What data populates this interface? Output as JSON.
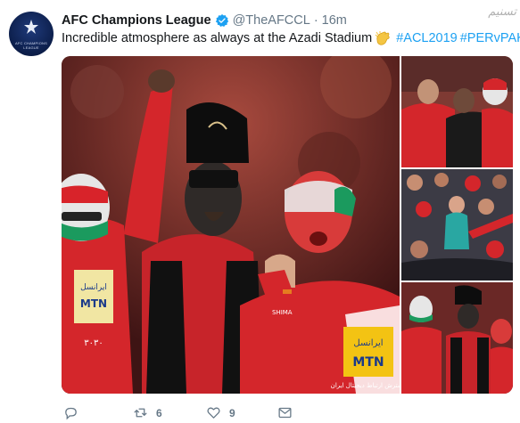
{
  "tweet": {
    "avatar_label": "AFC CHAMPIONS LEAGUE",
    "author_name": "AFC Champions League",
    "handle": "@TheAFCCL",
    "separator": "·",
    "time": "16m",
    "text": "Incredible atmosphere as always at the Azadi Stadium",
    "hashtags": [
      "#ACL2019",
      "#PERvPAK"
    ],
    "watermark": "تسنیم",
    "photos": {
      "main_sponsor_line1": "ایرانسل",
      "main_sponsor_line2": "MTN",
      "main_shirt_text": "گسترش ارتباط دیجیتال ایران",
      "left_sponsor_line1": "ایرانسل",
      "left_sponsor_line2": "MTN",
      "left_shirt_number": "۳۰۳۰",
      "brand": "SHIMA"
    },
    "actions": {
      "reply_count": "",
      "retweet_count": "6",
      "like_count": "9"
    }
  },
  "colors": {
    "link": "#1da1f2",
    "secondary_text": "#657786",
    "verified": "#1da1f2",
    "jersey_red": "#d4262b"
  }
}
